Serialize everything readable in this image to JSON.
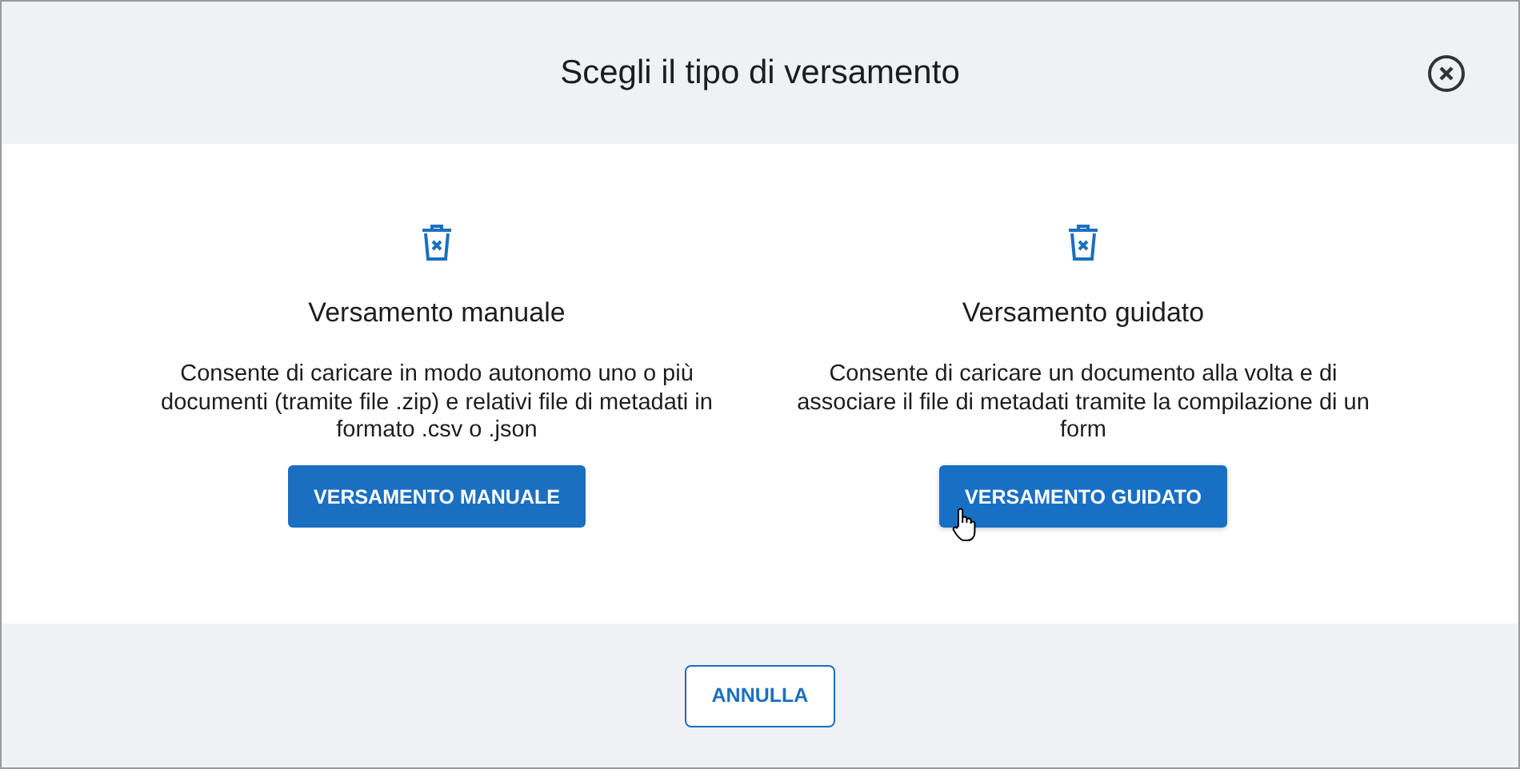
{
  "dialog": {
    "title": "Scegli il tipo di versamento"
  },
  "options": [
    {
      "title": "Versamento manuale",
      "description": "Consente di caricare in modo autonomo uno o più documenti (tramite file .zip) e relativi file di metadati in formato .csv o .json",
      "button": "VERSAMENTO MANUALE",
      "hovered": false
    },
    {
      "title": "Versamento guidato",
      "description": "Consente di caricare un documento alla volta e di associare il file di metadati tramite la compilazione di un form",
      "button": "VERSAMENTO GUIDATO",
      "hovered": true
    }
  ],
  "footer": {
    "button": "ANNULLA"
  }
}
